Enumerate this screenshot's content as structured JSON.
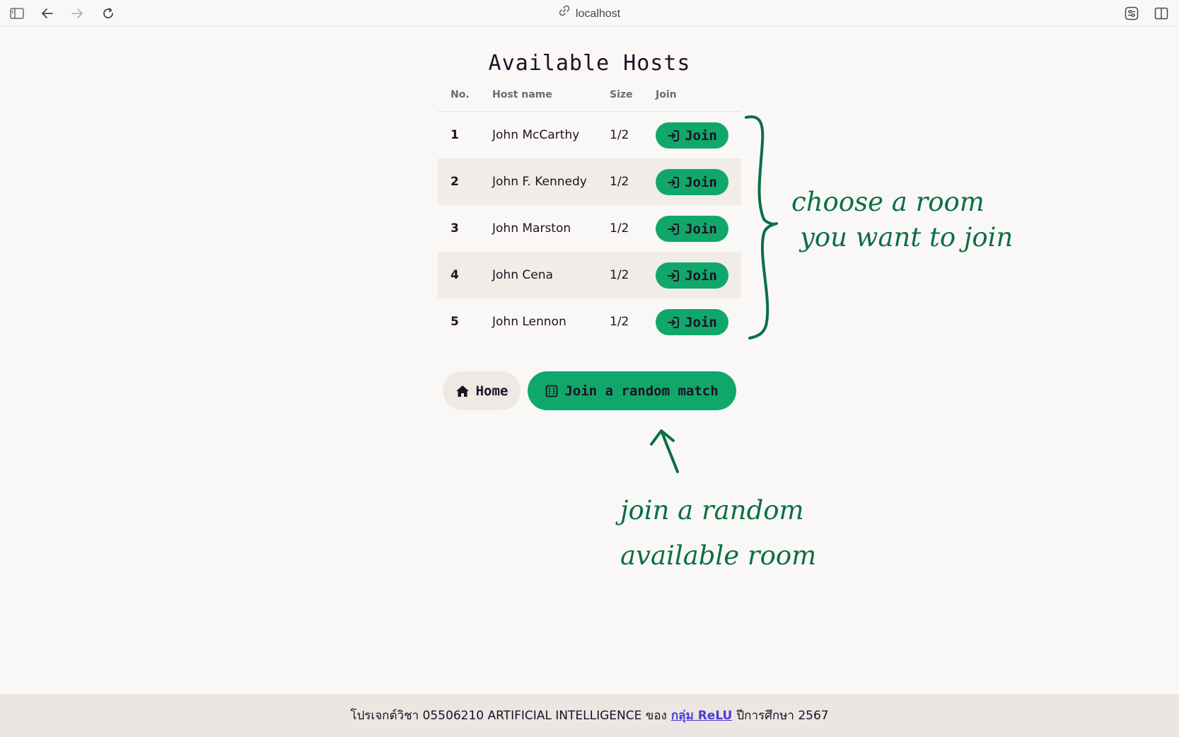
{
  "browser": {
    "url": "localhost"
  },
  "page": {
    "title": "Available Hosts"
  },
  "table": {
    "headers": {
      "no": "No.",
      "host_name": "Host name",
      "size": "Size",
      "join": "Join"
    },
    "rows": [
      {
        "no": "1",
        "name": "John McCarthy",
        "size": "1/2",
        "action": "Join"
      },
      {
        "no": "2",
        "name": "John F. Kennedy",
        "size": "1/2",
        "action": "Join"
      },
      {
        "no": "3",
        "name": "John Marston",
        "size": "1/2",
        "action": "Join"
      },
      {
        "no": "4",
        "name": "John Cena",
        "size": "1/2",
        "action": "Join"
      },
      {
        "no": "5",
        "name": "John Lennon",
        "size": "1/2",
        "action": "Join"
      }
    ]
  },
  "actions": {
    "home_label": "Home",
    "random_label": "Join a random match"
  },
  "annotations": {
    "rooms_note_line1": "choose a room",
    "rooms_note_line2": "you want to join",
    "random_note_line1": "join a random",
    "random_note_line2": "available room"
  },
  "footer": {
    "prefix": "โปรเจกต์วิชา 05506210 ARTIFICIAL INTELLIGENCE ของ",
    "link_text": "กลุ่ม ReLU",
    "suffix": "ปีการศึกษา 2567"
  },
  "colors": {
    "accent_green": "#10a76b",
    "annotation_green": "#0b6e48",
    "link": "#4b3ad9",
    "background": "#faf8f6"
  }
}
